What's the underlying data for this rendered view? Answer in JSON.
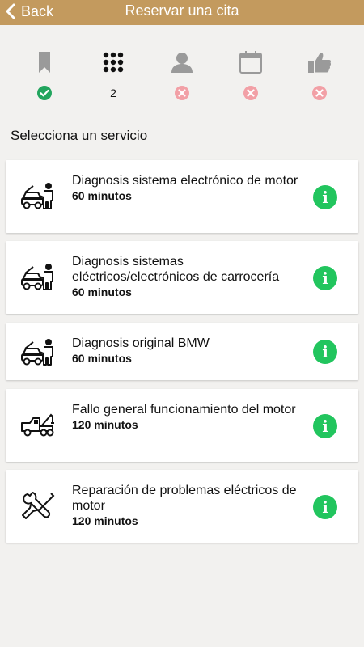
{
  "header": {
    "back_label": "Back",
    "title": "Reservar una cita"
  },
  "steps": [
    {
      "icon": "bookmark-icon",
      "status": "done"
    },
    {
      "icon": "grid-icon",
      "status": "current",
      "number": "2"
    },
    {
      "icon": "user-icon",
      "status": "pending"
    },
    {
      "icon": "calendar-icon",
      "status": "pending"
    },
    {
      "icon": "thumbs-up-icon",
      "status": "pending"
    }
  ],
  "section_title": "Selecciona un servicio",
  "services": [
    {
      "icon": "mechanic-car-icon",
      "name": "Diagnosis sistema electrónico de motor",
      "duration": "60 minutos"
    },
    {
      "icon": "mechanic-car-icon",
      "name": "Diagnosis sistemas eléctricos/electrónicos de carrocería",
      "duration": "60 minutos"
    },
    {
      "icon": "mechanic-car-icon",
      "name": "Diagnosis original BMW",
      "duration": "60 minutos"
    },
    {
      "icon": "tow-truck-icon",
      "name": "Fallo general funcionamiento del motor",
      "duration": "120 minutos"
    },
    {
      "icon": "wrench-screwdriver-icon",
      "name": "Reparación de problemas eléctricos de motor",
      "duration": "120 minutos"
    }
  ],
  "colors": {
    "header": "#c39a5e",
    "done": "#22a55e",
    "pending": "#f2a0a6",
    "step_icon_inactive": "#9a9a9a",
    "info": "#22c55e"
  }
}
